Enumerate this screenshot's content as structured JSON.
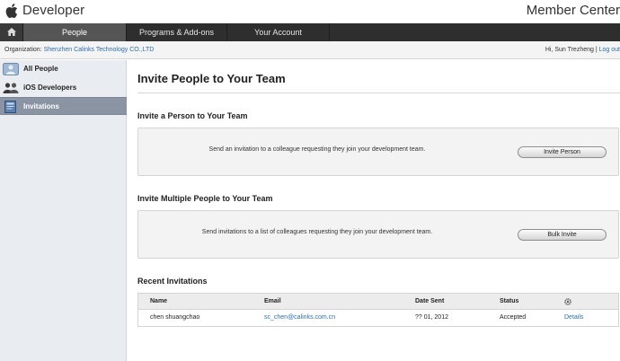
{
  "brand": {
    "name": "Developer",
    "section": "Member Center"
  },
  "nav": {
    "tabs": [
      {
        "label": "People",
        "active": true
      },
      {
        "label": "Programs & Add-ons",
        "active": false
      },
      {
        "label": "Your Account",
        "active": false
      }
    ]
  },
  "org_bar": {
    "org_label": "Organization:",
    "org_name": "Shenzhen Calinks Technology CO.,LTD",
    "greeting": "Hi, Sun Trezheng",
    "separator": "|",
    "logout": "Log out"
  },
  "sidebar": {
    "items": [
      {
        "label": "All People",
        "icon": "people-card-icon",
        "selected": false
      },
      {
        "label": "iOS Developers",
        "icon": "developers-icon",
        "selected": false
      },
      {
        "label": "Invitations",
        "icon": "invitations-icon",
        "selected": true
      }
    ]
  },
  "main": {
    "title": "Invite People to Your Team",
    "single": {
      "heading": "Invite a Person to Your Team",
      "text": "Send an invitation to a colleague requesting they join your development team.",
      "button": "Invite Person"
    },
    "bulk": {
      "heading": "Invite Multiple People to Your Team",
      "text": "Send invitations to a list of colleagues requesting they join your development team.",
      "button": "Bulk Invite"
    },
    "recent": {
      "heading": "Recent Invitations",
      "columns": [
        "Name",
        "Email",
        "Date Sent",
        "Status"
      ],
      "rows": [
        {
          "name": "chen shuangchao",
          "email": "sc_chen@calinks.com.cn",
          "date": "?? 01, 2012",
          "status": "Accepted",
          "action": "Details"
        }
      ]
    }
  },
  "colors": {
    "link": "#2a6fb3",
    "nav_bg": "#2e2e2e",
    "sidebar_selected": "#8a94a3"
  }
}
